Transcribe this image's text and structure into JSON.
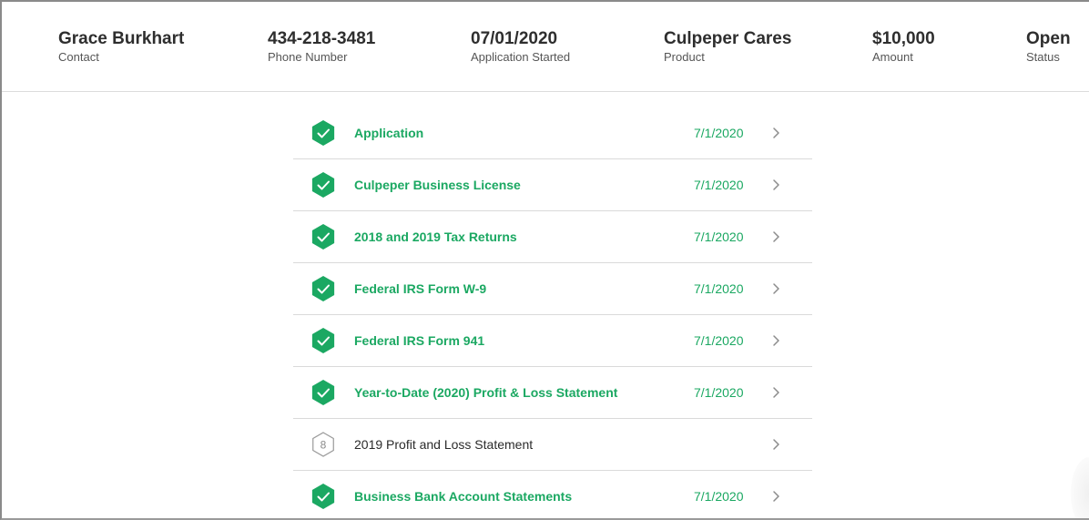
{
  "summary": {
    "contact": {
      "value": "Grace Burkhart",
      "label": "Contact"
    },
    "phone": {
      "value": "434-218-3481",
      "label": "Phone Number"
    },
    "started": {
      "value": "07/01/2020",
      "label": "Application Started"
    },
    "product": {
      "value": "Culpeper Cares",
      "label": "Product"
    },
    "amount": {
      "value": "$10,000",
      "label": "Amount"
    },
    "status": {
      "value": "Open",
      "label": "Status"
    }
  },
  "colors": {
    "accent_green": "#1ba862",
    "pending_grey": "#9a9a9a"
  },
  "checklist": [
    {
      "title": "Application",
      "date": "7/1/2020",
      "complete": true
    },
    {
      "title": "Culpeper Business License",
      "date": "7/1/2020",
      "complete": true
    },
    {
      "title": "2018 and 2019 Tax Returns",
      "date": "7/1/2020",
      "complete": true
    },
    {
      "title": "Federal IRS Form W-9",
      "date": "7/1/2020",
      "complete": true
    },
    {
      "title": "Federal IRS Form 941",
      "date": "7/1/2020",
      "complete": true
    },
    {
      "title": "Year-to-Date (2020) Profit & Loss Statement",
      "date": "7/1/2020",
      "complete": true
    },
    {
      "title": "2019 Profit and Loss Statement",
      "date": "",
      "complete": false,
      "step_number": "8"
    },
    {
      "title": "Business Bank Account Statements",
      "date": "7/1/2020",
      "complete": true
    }
  ],
  "icons": {
    "complete": "check-hexagon-icon",
    "pending": "number-hexagon-icon",
    "row_action": "chevron-right-icon"
  }
}
